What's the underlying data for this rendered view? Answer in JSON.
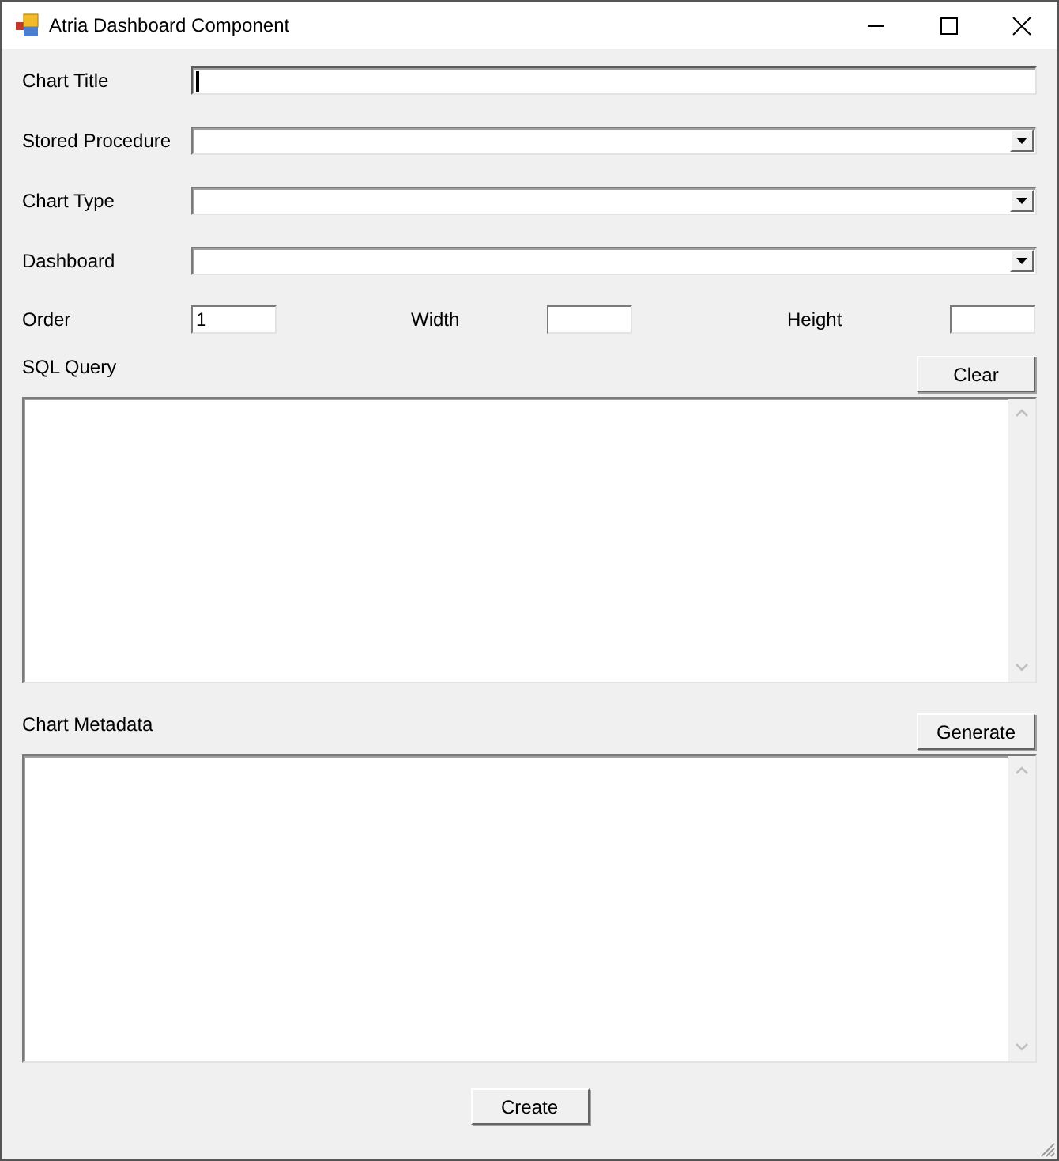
{
  "window": {
    "title": "Atria Dashboard Component"
  },
  "fields": [
    {
      "label": "Chart Title",
      "kind": "text",
      "focused": true
    },
    {
      "label": "Stored Procedure",
      "kind": "dropdown",
      "focused": false
    },
    {
      "label": "Chart Type",
      "kind": "dropdown",
      "focused": false
    },
    {
      "label": "Dashboard",
      "kind": "dropdown",
      "focused": false
    }
  ],
  "size_fields": [
    {
      "label": "Order",
      "value": "1"
    },
    {
      "label": "Width"
    },
    {
      "label": "Height"
    }
  ],
  "sections": [
    {
      "label": "SQL Query",
      "button": "Clear"
    },
    {
      "label": "Chart Metadata",
      "button": "Generate"
    }
  ],
  "create_button": "Create"
}
